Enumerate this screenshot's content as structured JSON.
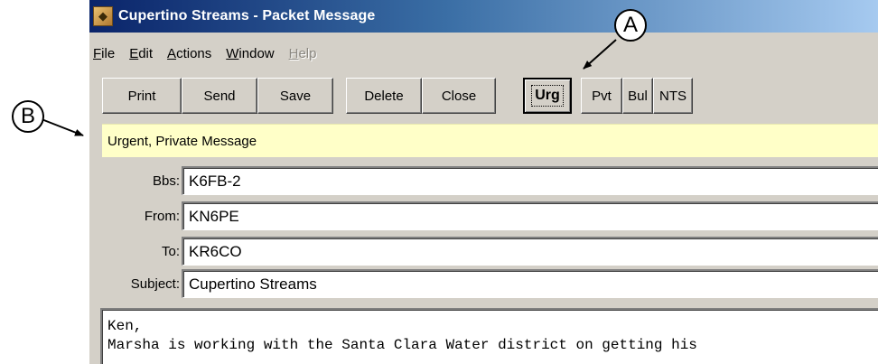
{
  "window": {
    "title": "Cupertino Streams - Packet Message",
    "app_icon": "app-icon"
  },
  "menu": {
    "items": [
      {
        "label": "File",
        "enabled": true
      },
      {
        "label": "Edit",
        "enabled": true
      },
      {
        "label": "Actions",
        "enabled": true
      },
      {
        "label": "Window",
        "enabled": true
      },
      {
        "label": "Help",
        "enabled": false
      }
    ]
  },
  "toolbar": {
    "buttons": [
      {
        "label": "Print"
      },
      {
        "label": "Send"
      },
      {
        "label": "Save"
      },
      {
        "label": "Delete"
      },
      {
        "label": "Close"
      },
      {
        "label": "Urg",
        "pressed": true
      },
      {
        "label": "Pvt"
      },
      {
        "label": "Bul"
      },
      {
        "label": "NTS"
      }
    ]
  },
  "status": {
    "text": "Urgent, Private Message",
    "background": "#ffffc8"
  },
  "fields": [
    {
      "label": "Bbs:",
      "value": "K6FB-2"
    },
    {
      "label": "From:",
      "value": "KN6PE"
    },
    {
      "label": "To:",
      "value": "KR6CO"
    },
    {
      "label": "Subject:",
      "value": "Cupertino Streams"
    }
  ],
  "message_body": {
    "lines": [
      "Ken,",
      "Marsha is working with the Santa Clara Water district on getting his"
    ]
  },
  "callouts": {
    "a": "A",
    "b": "B"
  },
  "colors": {
    "titlebar_start": "#0a246a",
    "titlebar_end": "#a6caf0",
    "window_face": "#d4d0c8"
  }
}
